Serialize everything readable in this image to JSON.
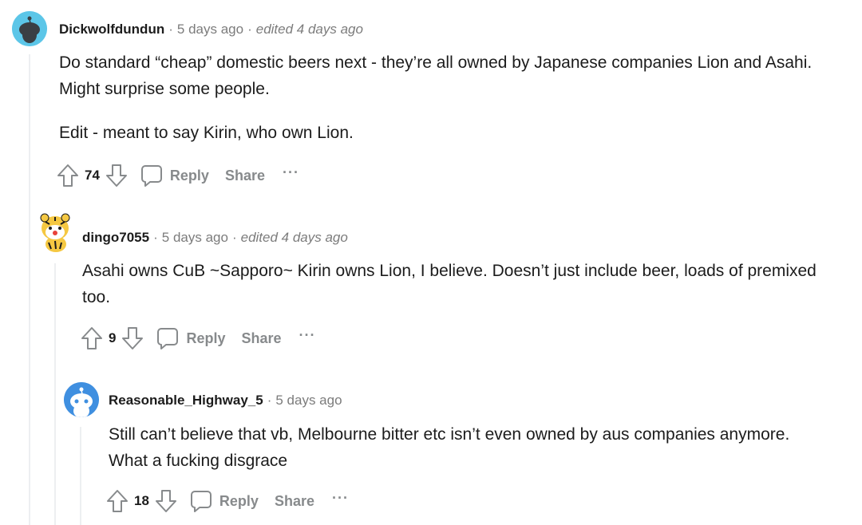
{
  "comments": [
    {
      "author": "Dickwolfdundun",
      "time": "5 days ago",
      "edited": "edited 4 days ago",
      "paragraphs": [
        "Do standard “cheap” domestic beers next - they’re all owned by Japanese companies Lion and Asahi. Might surprise some people.",
        "Edit - meant to say Kirin, who own Lion."
      ],
      "score": "74",
      "reply_label": "Reply",
      "share_label": "Share",
      "more_label": "···"
    },
    {
      "author": "dingo7055",
      "time": "5 days ago",
      "edited": "edited 4 days ago",
      "paragraphs": [
        "Asahi owns CuB ~Sapporo~ Kirin owns Lion, I believe. Doesn’t just include beer, loads of premixed too."
      ],
      "score": "9",
      "reply_label": "Reply",
      "share_label": "Share",
      "more_label": "···"
    },
    {
      "author": "Reasonable_Highway_5",
      "time": "5 days ago",
      "paragraphs": [
        "Still can’t believe that vb, Melbourne bitter etc isn’t even owned by aus companies anymore. What a fucking disgrace"
      ],
      "score": "18",
      "reply_label": "Reply",
      "share_label": "Share",
      "more_label": "···"
    }
  ],
  "separator": "·",
  "colors": {
    "avatar_1_bg": "#5cc6e8",
    "avatar_3_bg": "#3f8fe0",
    "muted": "#878a8c",
    "thread_line": "#edeff1"
  },
  "icons": [
    "upvote-icon",
    "downvote-icon",
    "comment-bubble-icon",
    "snoo-icon"
  ]
}
